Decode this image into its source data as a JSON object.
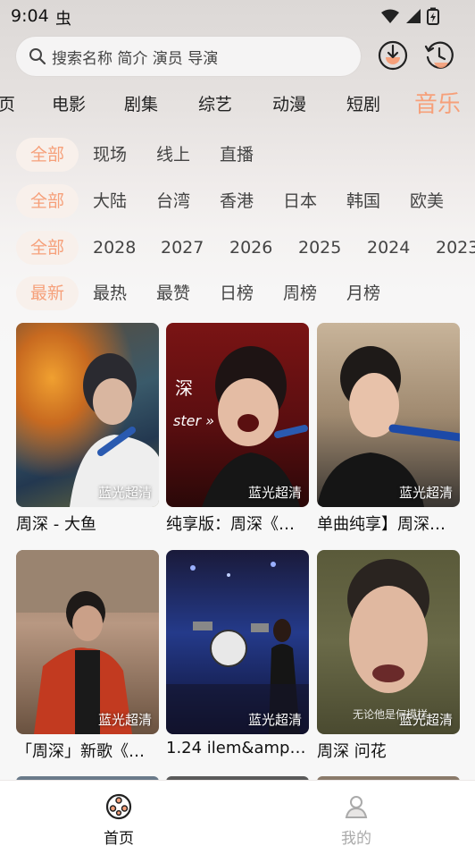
{
  "status_bar": {
    "time": "9:04",
    "app_badge": "虫"
  },
  "search": {
    "placeholder": "搜索名称 简介 演员 导演"
  },
  "category_tabs": [
    "页",
    "电影",
    "剧集",
    "综艺",
    "动漫",
    "短剧",
    "音乐"
  ],
  "active_category": "音乐",
  "filters": {
    "type": [
      "全部",
      "现场",
      "线上",
      "直播"
    ],
    "region": [
      "全部",
      "大陆",
      "台湾",
      "香港",
      "日本",
      "韩国",
      "欧美"
    ],
    "year": [
      "全部",
      "2028",
      "2027",
      "2026",
      "2025",
      "2024",
      "2023"
    ],
    "sort": [
      "最新",
      "最热",
      "最赞",
      "日榜",
      "周榜",
      "月榜"
    ]
  },
  "videos": [
    {
      "title": "周深 - 大鱼",
      "badge": "蓝光超清"
    },
    {
      "title": "纯享版：周深《…",
      "badge": "蓝光超清"
    },
    {
      "title": "单曲纯享】周深…",
      "badge": "蓝光超清"
    },
    {
      "title": "「周深」新歌《…",
      "badge": "蓝光超清"
    },
    {
      "title": "1.24 ilem&amp;a…",
      "badge": "蓝光超清"
    },
    {
      "title": "周深 问花",
      "badge": "蓝光超清"
    }
  ],
  "bottom_nav": {
    "home": "首页",
    "mine": "我的"
  },
  "colors": {
    "accent": "#f6a07a",
    "active_chip_bg": "#f8f0eb"
  }
}
